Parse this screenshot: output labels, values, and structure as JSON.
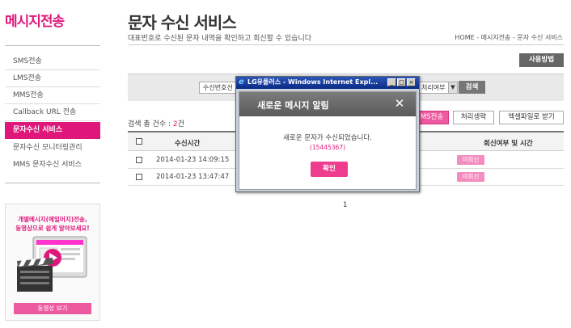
{
  "sidebar": {
    "brand": "메시지전송",
    "items": [
      {
        "label": "SMS전송"
      },
      {
        "label": "LMS전송"
      },
      {
        "label": "MMS전송"
      },
      {
        "label": "Callback URL 전송"
      },
      {
        "label": "문자수신 서비스"
      },
      {
        "label": "문자수신 모니터링관리"
      },
      {
        "label": "MMS 문자수신 서비스"
      }
    ],
    "promo": {
      "line1": "개별메시지(메일머지)전송,",
      "line2": "동영상으로 쉽게 알아보세요!",
      "button": "동영상 보기"
    }
  },
  "header": {
    "title": "문자 수신 서비스",
    "subtitle": "대표번호로 수신된 문자 내역을 확인하고 회신할 수 있습니다",
    "breadcrumb": "HOME - 메시지전송 - 문자 수신 서비스",
    "usage_button": "사용방법"
  },
  "search": {
    "field1_value": "수신번호선",
    "field2_value": "처리여부",
    "button": "검색"
  },
  "results": {
    "total_label": "검색 총 건수 : ",
    "total_count": "2",
    "total_unit": "건",
    "buttons": {
      "sms": "MS전송",
      "process": "처리생략",
      "excel": "엑셀파일로 받기"
    }
  },
  "table": {
    "headers": {
      "time": "수신시간",
      "reply": "회신여부 및 시간"
    },
    "rows": [
      {
        "time": "2014-01-23 14:09:15",
        "reply": "미회신"
      },
      {
        "time": "2014-01-23 13:47:47",
        "reply": "미회신"
      }
    ],
    "page": "1"
  },
  "window": {
    "title": "LG유플러스 - Windows Internet Expl...",
    "dialog_title": "새로운 메시지 알림",
    "message": "새로운 문자가 수신되었습니다.",
    "number": "(15445367)",
    "ok_button": "확인"
  }
}
